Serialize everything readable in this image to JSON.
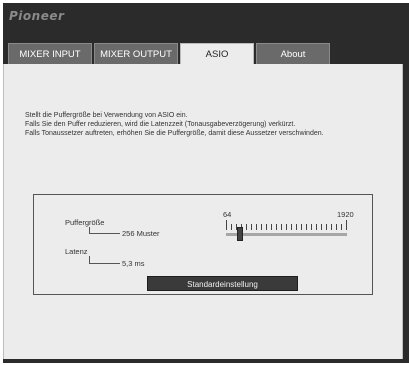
{
  "app": {
    "logo": "Pioneer"
  },
  "tabs": [
    {
      "label": "MIXER INPUT",
      "active": false
    },
    {
      "label": "MIXER OUTPUT",
      "active": false
    },
    {
      "label": "ASIO",
      "active": true
    },
    {
      "label": "About",
      "active": false
    }
  ],
  "description": [
    "Stellt die Puffergröße bei Verwendung von ASIO ein.",
    "Falls Sie den Puffer reduzieren, wird die Latenzzeit (Tonausgabeverzögerung) verkürzt.",
    "Falls Tonaussetzer auftreten, erhöhen Sie die Puffergröße, damit diese Aussetzer verschwinden."
  ],
  "buffer": {
    "label": "Puffergröße",
    "value": "256 Muster",
    "min_label": "64",
    "max_label": "1920",
    "slider_fraction": 0.1
  },
  "latency": {
    "label": "Latenz",
    "value": "5,3 ms"
  },
  "default_button": "Standardeinstellung",
  "colors": {
    "window": "#2b2b2b",
    "content": "#ececec",
    "tab": "#6a6a6a",
    "button": "#3a3a3a"
  }
}
